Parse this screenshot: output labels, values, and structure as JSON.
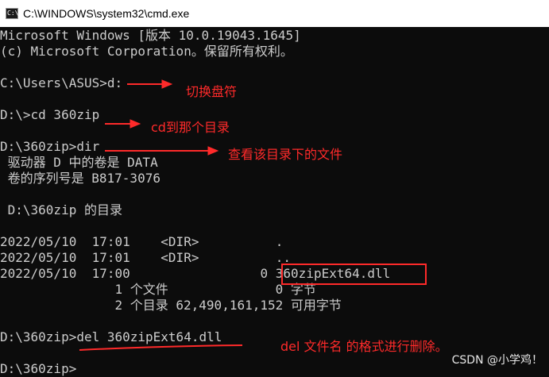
{
  "window": {
    "title": "C:\\WINDOWS\\system32\\cmd.exe",
    "icon": "cmd-icon",
    "icon_glyph": "C:\\"
  },
  "console": {
    "lines": [
      "Microsoft Windows [版本 10.0.19043.1645]",
      "(c) Microsoft Corporation。保留所有权利。",
      "",
      "C:\\Users\\ASUS>d:",
      "",
      "D:\\>cd 360zip",
      "",
      "D:\\360zip>dir",
      " 驱动器 D 中的卷是 DATA",
      " 卷的序列号是 B817-3076",
      "",
      " D:\\360zip 的目录",
      "",
      "2022/05/10  17:01    <DIR>          .",
      "2022/05/10  17:01    <DIR>          ..",
      "2022/05/10  17:00                 0 360zipExt64.dll",
      "               1 个文件              0 字节",
      "               2 个目录 62,490,161,152 可用字节",
      "",
      "D:\\360zip>del 360zipExt64.dll",
      "",
      "D:\\360zip>"
    ]
  },
  "annotations": {
    "switch_drive": "切换盘符",
    "cd_dir": "cd到那个目录",
    "view_files": "查看该目录下的文件",
    "del_format": "del 文件名  的格式进行删除。"
  },
  "watermark": "CSDN @小学鸡！",
  "colors": {
    "background": "#0c0c0c",
    "text": "#cccccc",
    "annotation": "#ff2a2a",
    "titlebar": "#ffffff"
  }
}
